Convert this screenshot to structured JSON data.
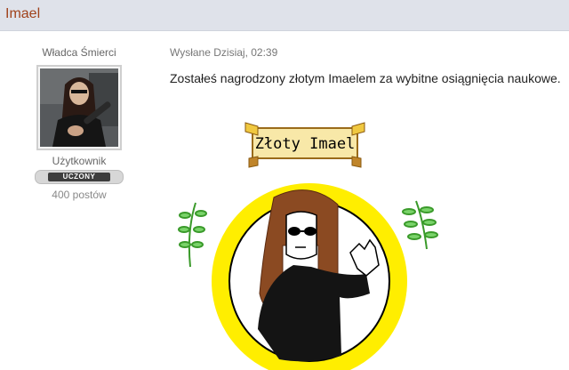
{
  "topic": {
    "title": "Imael"
  },
  "author": {
    "name": "Władca Śmierci",
    "role": "Użytkownik",
    "rank_badge": "UCZONY",
    "post_count": "400 postów"
  },
  "post": {
    "meta": "Wysłane Dzisiaj, 02:39",
    "text": "Zostałeś nagrodzony złotym Imaelem za wybitne osiągnięcia naukowe.",
    "image": {
      "scroll_text": "Złoty Imael"
    }
  },
  "colors": {
    "topbar": "#dfe2ea",
    "title": "#a0421c",
    "medal_gold": "#ffee00",
    "hair": "#8b4a22"
  }
}
